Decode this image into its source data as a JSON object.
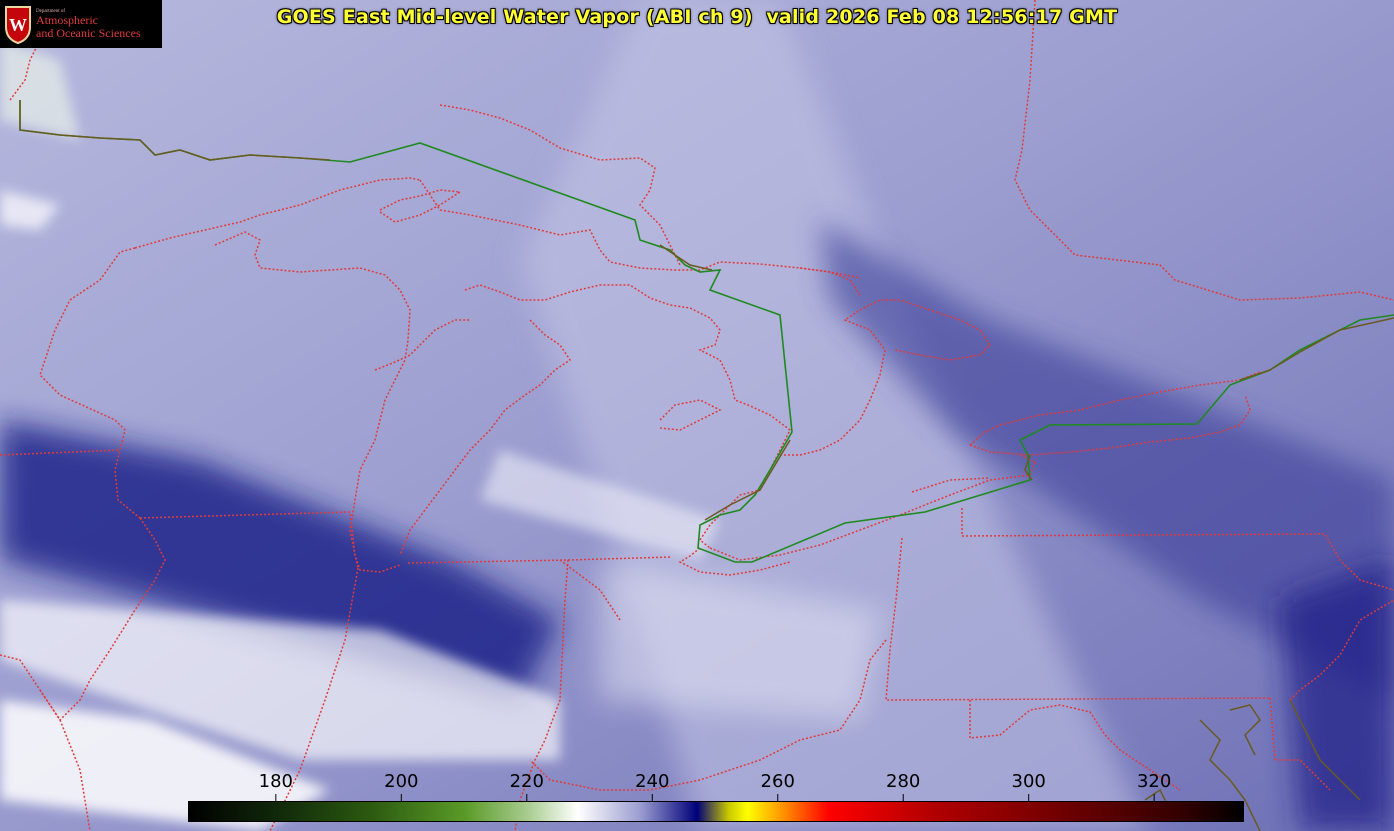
{
  "title": "GOES East Mid-level Water Vapor (ABI ch 9)  valid 2026 Feb 08 12:56:17 GMT",
  "logo": {
    "line_small": "Department of",
    "line1": "Atmospheric",
    "line2": "and Oceanic Sciences",
    "crest_letter": "W"
  },
  "colorbar": {
    "ticks": [
      "180",
      "200",
      "220",
      "240",
      "260",
      "280",
      "300",
      "320"
    ],
    "tick_values": [
      180,
      200,
      220,
      240,
      260,
      280,
      300,
      320
    ],
    "range": [
      166,
      334
    ],
    "stops": [
      {
        "v": 166,
        "c": "#000000"
      },
      {
        "v": 180,
        "c": "#10280a"
      },
      {
        "v": 195,
        "c": "#2c5a10"
      },
      {
        "v": 210,
        "c": "#5a9a28"
      },
      {
        "v": 220,
        "c": "#a8cc90"
      },
      {
        "v": 228,
        "c": "#ffffff"
      },
      {
        "v": 238,
        "c": "#9a9cd0"
      },
      {
        "v": 247,
        "c": "#00007a"
      },
      {
        "v": 252,
        "c": "#c8c800"
      },
      {
        "v": 255,
        "c": "#ffff00"
      },
      {
        "v": 260,
        "c": "#ffa000"
      },
      {
        "v": 268,
        "c": "#ff0000"
      },
      {
        "v": 285,
        "c": "#b00000"
      },
      {
        "v": 305,
        "c": "#700000"
      },
      {
        "v": 325,
        "c": "#300000"
      },
      {
        "v": 334,
        "c": "#000000"
      }
    ]
  },
  "colors": {
    "state_borders": "#e23a3a",
    "intl_border": "#1f8a1f",
    "coast": "#6b5a20",
    "title_text": "#ffff33",
    "logo_red": "#e33a3a"
  }
}
